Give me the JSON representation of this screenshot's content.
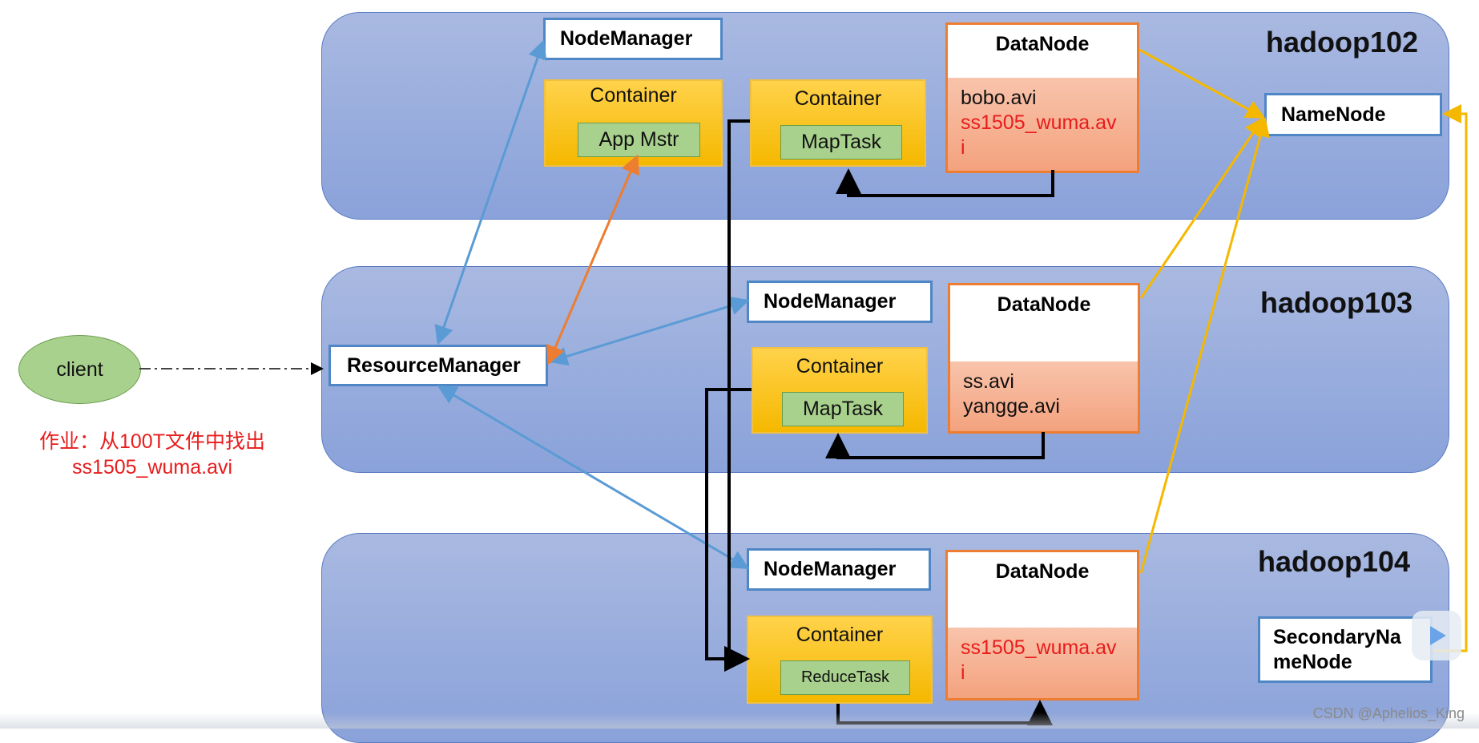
{
  "hosts": {
    "h102": {
      "label": "hadoop102"
    },
    "h103": {
      "label": "hadoop103"
    },
    "h104": {
      "label": "hadoop104"
    }
  },
  "nodes": {
    "nodemanager": "NodeManager",
    "resourcemanager": "ResourceManager",
    "namenode": "NameNode",
    "secondarynamenode": "SecondaryNameNode",
    "datanode": "DataNode",
    "container": "Container",
    "app_master": "App Mstr",
    "map_task": "MapTask",
    "reduce_task": "ReduceTask",
    "client": "client"
  },
  "files": {
    "h102_a": "bobo.avi",
    "h102_b": "ss1505_wuma.avi",
    "h103_a": "ss.avi",
    "h103_b": "yangge.avi",
    "h104_a": "ss1505_wuma.avi"
  },
  "job_note": {
    "line1": "作业：从100T文件中找出",
    "line2": "ss1505_wuma.avi"
  },
  "watermark": "CSDN @Aphelios_King",
  "colors": {
    "host_fill": "#8aa2da",
    "yarn_arrow": "#5b9bd5",
    "hdfs_arrow": "#f5b800",
    "am_arrow": "#ed7d31",
    "highlight_text": "#e81c1c"
  }
}
